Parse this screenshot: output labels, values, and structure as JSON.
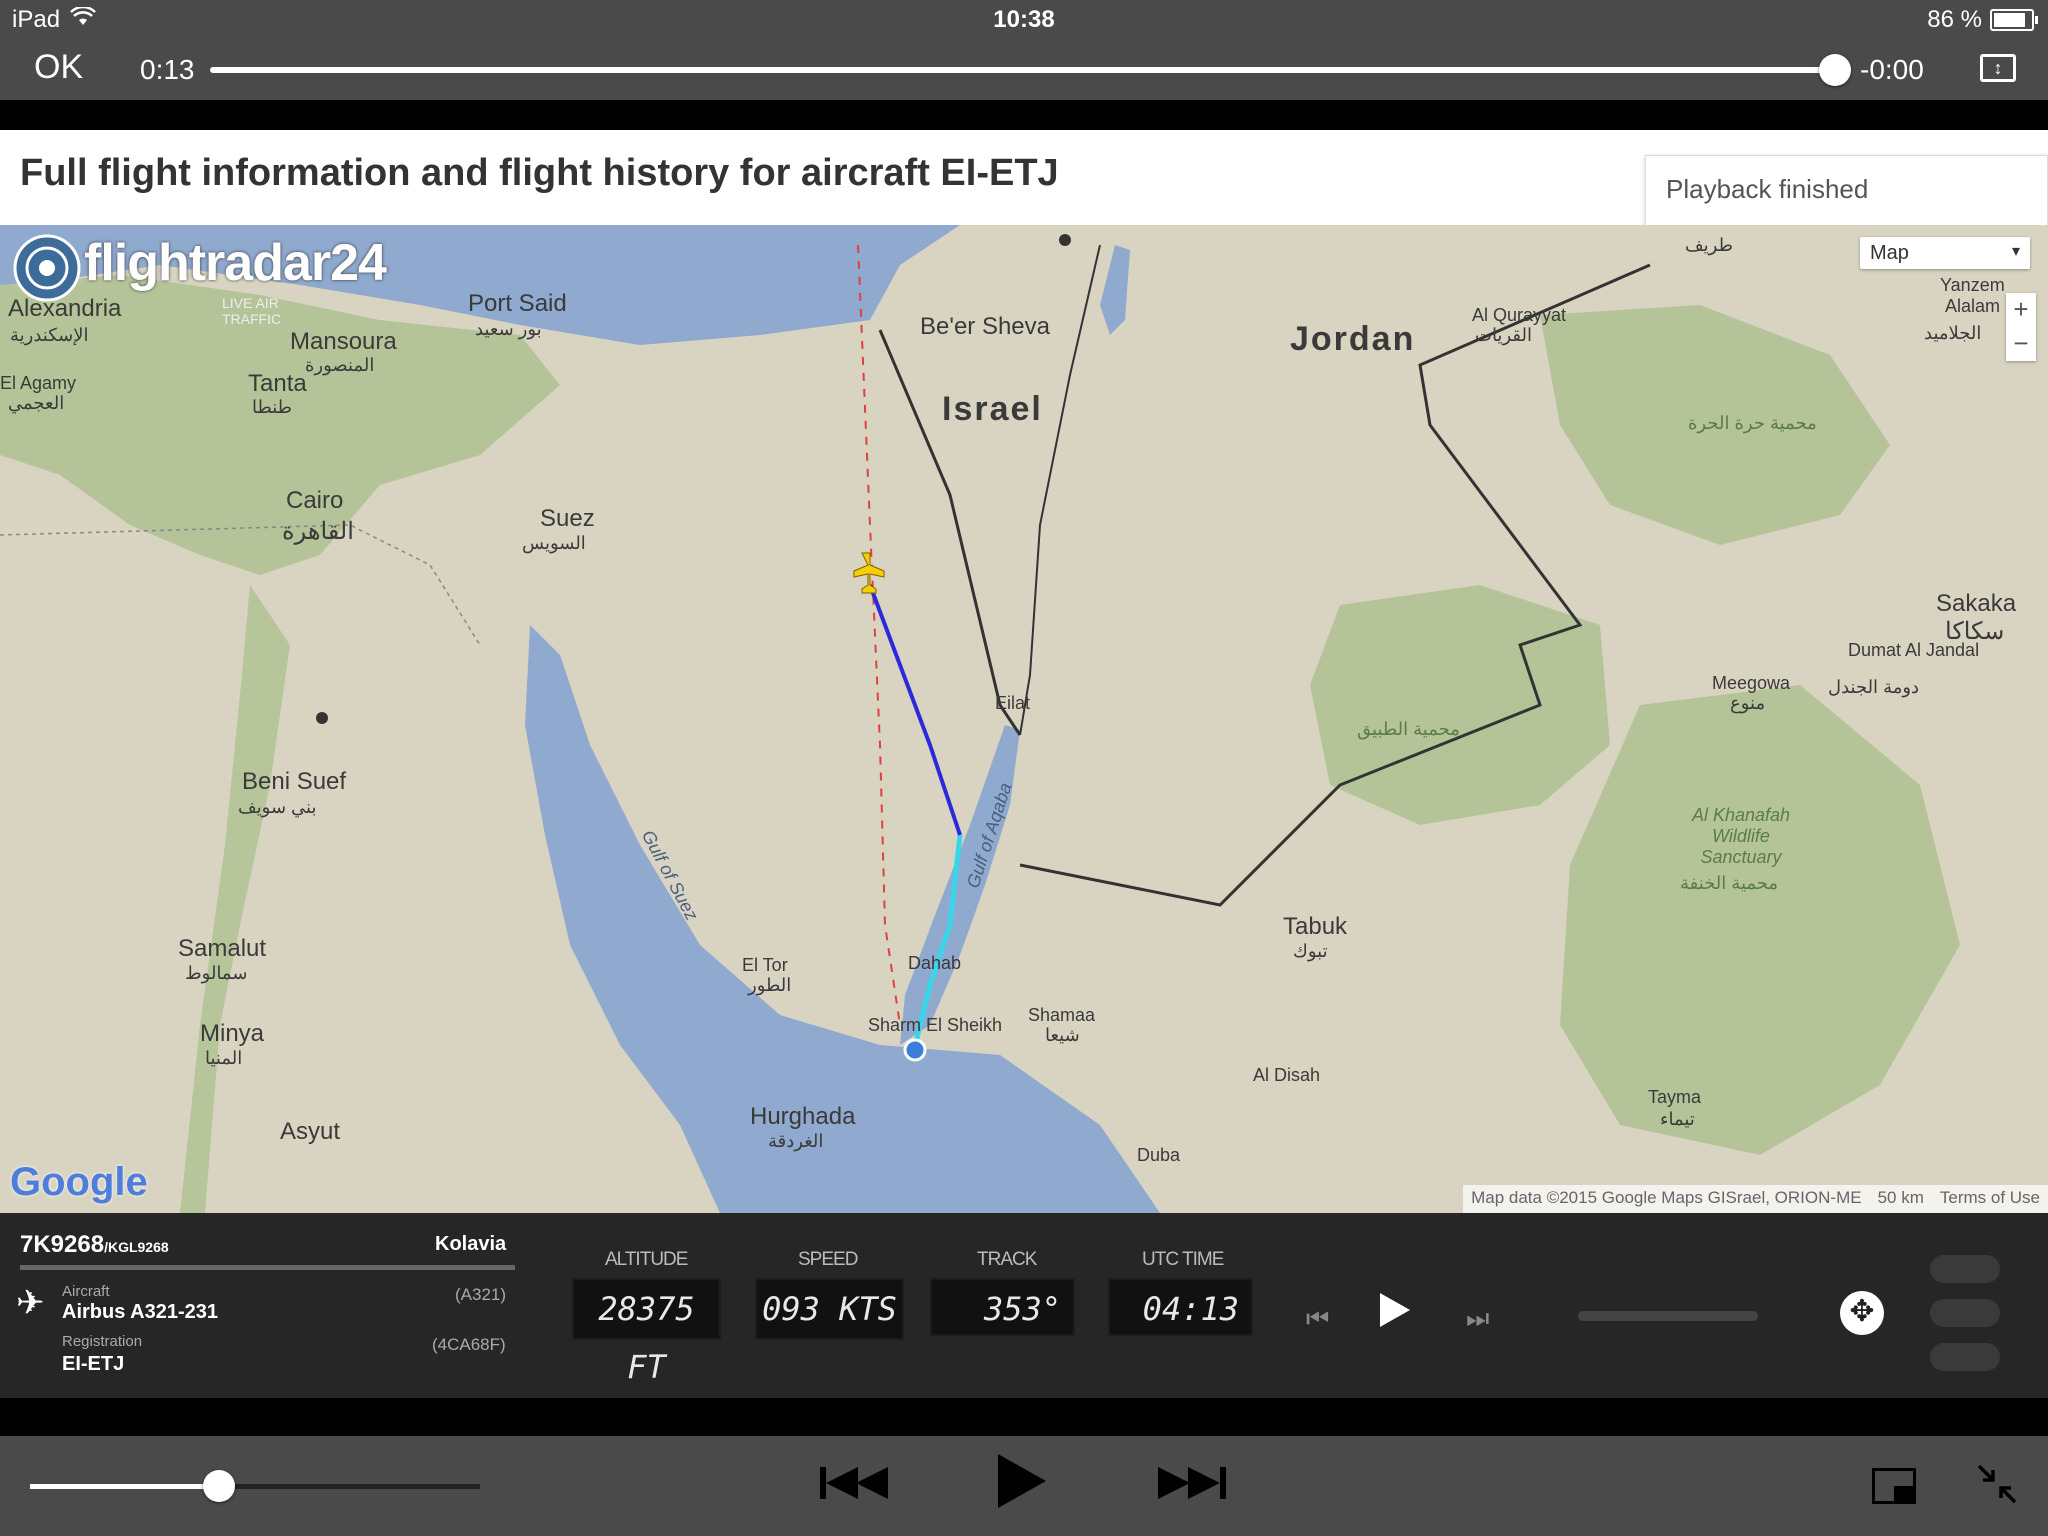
{
  "statusbar": {
    "device": "iPad",
    "time": "10:38",
    "battery": "86 %",
    "battery_level": 0.86
  },
  "player_top": {
    "done_label": "OK",
    "elapsed": "0:13",
    "remaining": "-0:00",
    "progress": 1.0
  },
  "page": {
    "title": "Full flight information and flight history for aircraft EI-ETJ",
    "playback_status": "Playback finished"
  },
  "map": {
    "logo_name": "flightradar24",
    "logo_sub": "LIVE AIR TRAFFIC",
    "map_type": "Map",
    "zoom_in": "+",
    "zoom_out": "−",
    "google": "Google",
    "attribution": [
      "Map data ©2015 Google  Maps GISrael, ORION-ME",
      "50 km",
      "Terms of Use"
    ],
    "labels": {
      "jordan": "Jordan",
      "israel": "Israel",
      "port_said": "Port Said",
      "port_said_ar": "بور سعيد",
      "alexandria": "Alexandria",
      "alexandria_ar": "الإسكندرية",
      "el_agamy": "El Agamy",
      "el_agamy_ar": "العجمي",
      "mansoura": "Mansoura",
      "mansoura_ar": "المنصورة",
      "tanta": "Tanta",
      "tanta_ar": "طنطا",
      "cairo": "Cairo",
      "cairo_ar": "القاهرة",
      "suez": "Suez",
      "suez_ar": "السويس",
      "beersheva": "Be'er Sheva",
      "al_qurayyat": "Al Qurayyat",
      "al_qurayyat_ar": "القريات",
      "tarif_ar": "طريف",
      "beni_suef": "Beni Suef",
      "beni_suef_ar": "بني سويف",
      "samalut": "Samalut",
      "samalut_ar": "سمالوط",
      "minya": "Minya",
      "minya_ar": "المنيا",
      "asyut": "Asyut",
      "el_tor": "El Tor",
      "el_tor_ar": "الطور",
      "dahab": "Dahab",
      "sharm": "Sharm El Sheikh",
      "hurghada": "Hurghada",
      "hurghada_ar": "الغردقة",
      "tabuk": "Tabuk",
      "tabuk_ar": "تبوك",
      "shamaa": "Shamaa",
      "shamaa_ar": "شيعا",
      "al_disah": "Al Disah",
      "duba": "Duba",
      "tayma": "Tayma",
      "tayma_ar": "تيماء",
      "sakaka": "Sakaka",
      "sakaka_ar": "سكاكا",
      "dumat": "Dumat Al Jandal",
      "dumat_ar": "دومة الجندل",
      "meegowa": "Meegowa",
      "meegowa_ar": "منوع",
      "khunfah": "Al Khanafah Wildlife Sanctuary",
      "khunfah_ar": "محمية الخنفة",
      "reserve1_ar": "محمية حرة الحرة",
      "reserve2_ar": "محمية الطبيق",
      "gulf_suez": "Gulf of Suez",
      "gulf_aqaba": "Gulf of Aqaba",
      "eilat": "Eilat",
      "yanzem": "Yanzem Alalam",
      "yanzem_ar": "الجلاميد"
    },
    "colors": {
      "land": "#d9d4c2",
      "water": "#8fa9cf",
      "green": "#a8bf8a",
      "track_dark": "#2a2adb",
      "track_light": "#37d6e8"
    }
  },
  "flight": {
    "flight_number": "7K9268",
    "callsign": "/KGL9268",
    "airline": "Kolavia",
    "aircraft_label": "Aircraft",
    "aircraft": "Airbus A321-231",
    "aircraft_code": "(A321)",
    "registration_label": "Registration",
    "registration": "EI-ETJ",
    "hex_code": "(4CA68F)",
    "altitude_label": "ALTITUDE",
    "altitude": "28375 FT",
    "speed_label": "SPEED",
    "speed": "093 KTS",
    "track_label": "TRACK",
    "track": "353°",
    "utc_label": "UTC TIME",
    "utc": "04:13"
  }
}
